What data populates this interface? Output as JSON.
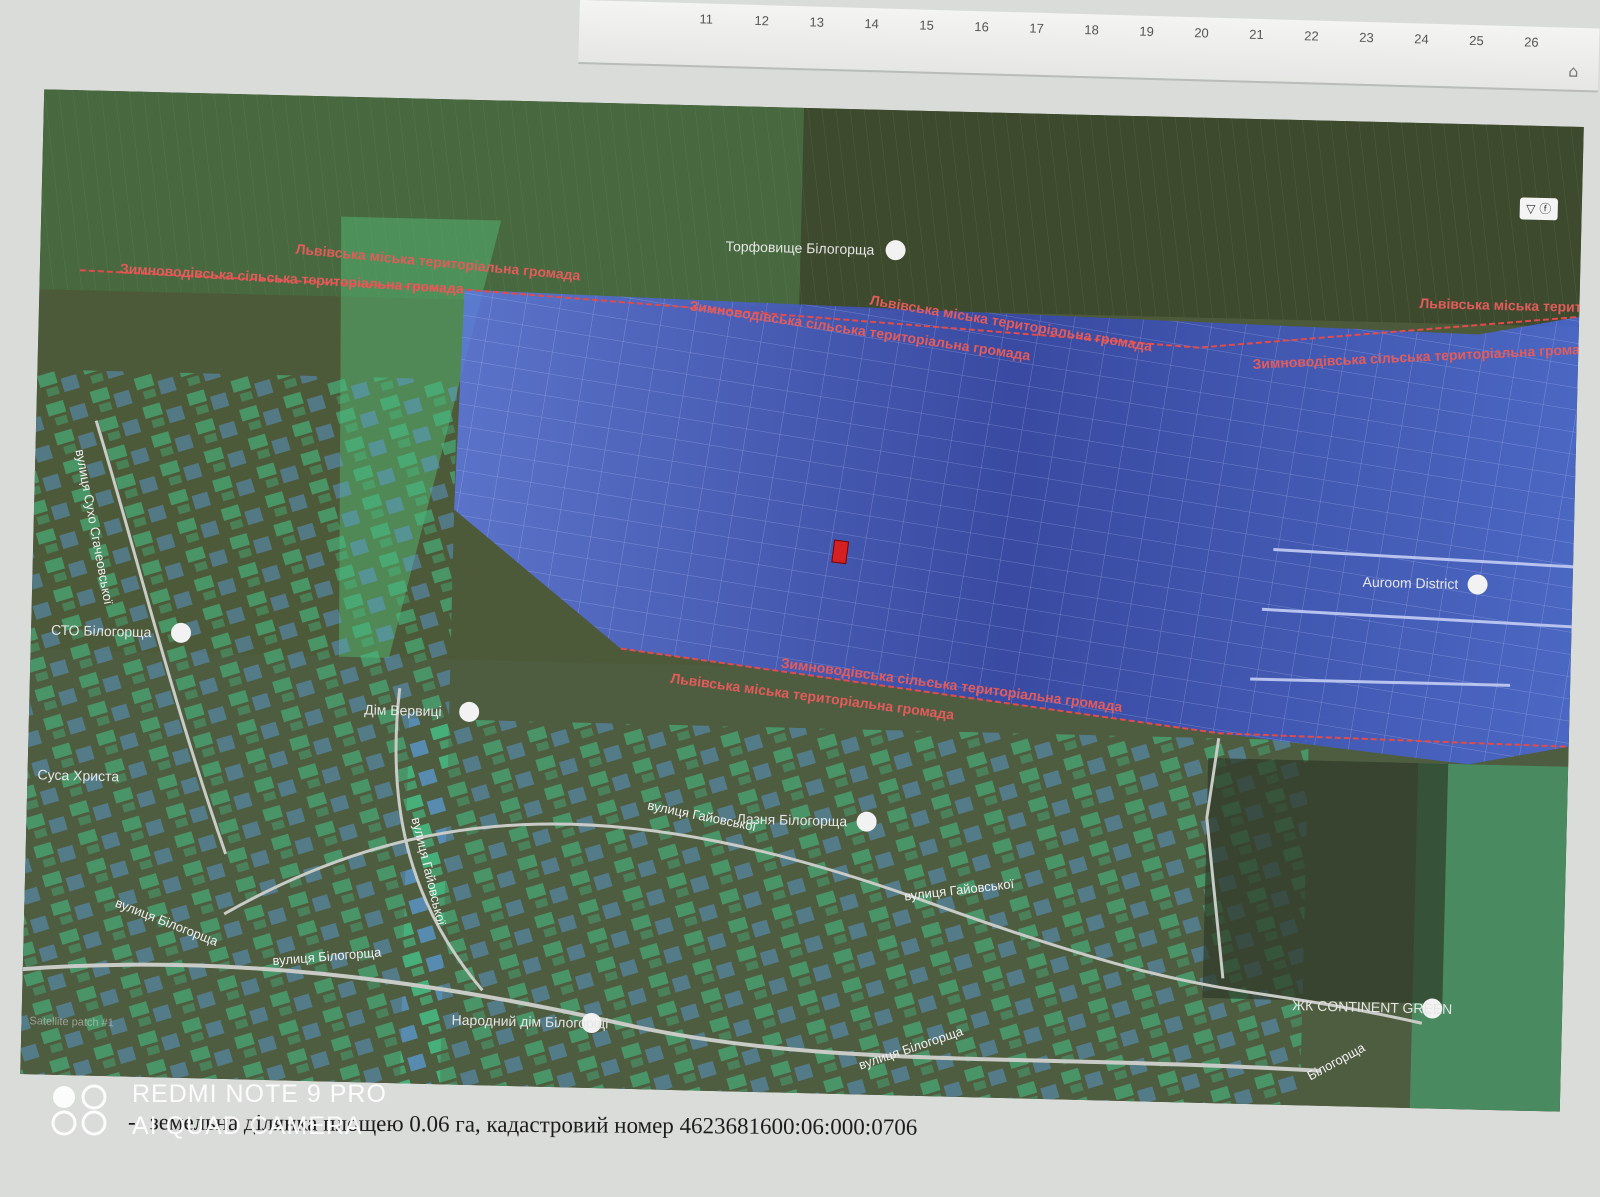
{
  "ruler": {
    "ticks": [
      "11",
      "12",
      "13",
      "14",
      "15",
      "16",
      "17",
      "18",
      "19",
      "20",
      "21",
      "22",
      "23",
      "24",
      "25",
      "26"
    ]
  },
  "map": {
    "community_labels": [
      "Львівська міська територіальна громада",
      "Зимноводівська сільська територіальна громада",
      "Львівська міська територіальна громада",
      "Зимноводівська сільська територіальна громада",
      "Зимноводівська сільська територіальна громада",
      "Львівська міська територіальна громада",
      "Львівська міська територіальна громада",
      "Зимноводівська сільська територіальна громада"
    ],
    "pois": [
      "Торфовище Білогорща",
      "Aurоom District",
      "СТО Білогорща",
      "Дім Вервиці",
      "Лазня Білогорща",
      "Народний дім Білогорщі",
      "ЖК CONTINENT GREEN",
      "Суса Христа"
    ],
    "streets": [
      "вулиця Сухо Сгачеовської",
      "вулиця Гайовської",
      "вулиця Гайовської",
      "вулиця Гайовської",
      "вулиця Білогорща",
      "вулиця Білогорща",
      "вулиця Білогорща",
      "Білогорща"
    ],
    "corner_label": "Satellite patch #1",
    "selected_parcel_color": "#d42020",
    "zone_color_zymnovodivska": "#3d5bd6",
    "zone_color_lviv": "#45c488",
    "boundary_color": "#e14b4b"
  },
  "caption": {
    "dash": "-",
    "text": "земельна ділянка площею 0.06 га, кадастровий номер  4623681600:06:000:0706"
  },
  "watermark": {
    "line1": "REDMI NOTE 9 PRO",
    "line2": "AI QUAD CAMERA"
  }
}
